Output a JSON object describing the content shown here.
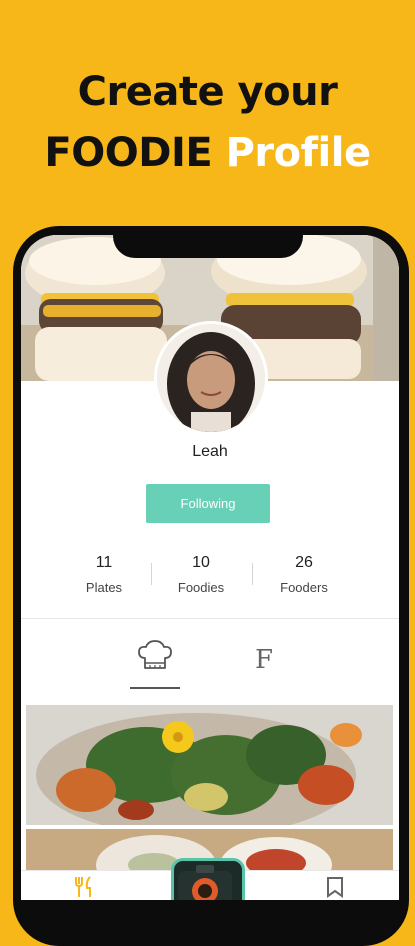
{
  "headline": {
    "line1": "Create your",
    "line2_dark": "FOODIE",
    "line2_light": "Profile"
  },
  "profile": {
    "name": "Leah",
    "follow_label": "Following"
  },
  "stats": [
    {
      "value": "11",
      "label": "Plates"
    },
    {
      "value": "10",
      "label": "Foodies"
    },
    {
      "value": "26",
      "label": "Fooders"
    }
  ],
  "tabs": [
    {
      "icon": "chef-hat-icon",
      "active": true
    },
    {
      "icon": "f-letter-icon",
      "glyph": "F",
      "active": false
    }
  ],
  "bottom_nav": [
    {
      "icon": "fork-knife-icon"
    },
    {
      "icon": "camera-icon"
    },
    {
      "icon": "bookmark-icon"
    }
  ],
  "colors": {
    "background": "#F7B718",
    "accent_teal": "#67D0B6",
    "headline_dark": "#111111",
    "headline_light": "#FFFFFF"
  }
}
